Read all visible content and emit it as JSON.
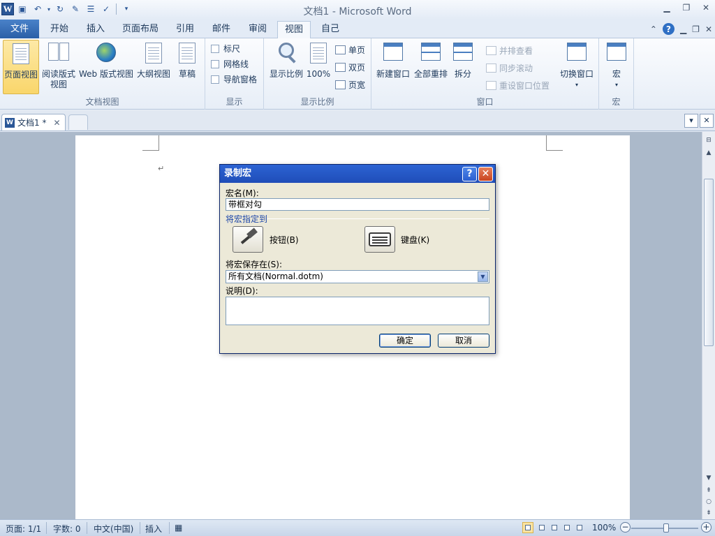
{
  "window": {
    "title": "文档1 - Microsoft Word",
    "app_icon_letter": "W"
  },
  "quick_access": {
    "save_icon": "save-icon",
    "undo_icon": "undo-icon",
    "redo_icon": "redo-icon",
    "customize_icon": "customize-arrow-icon"
  },
  "tabs": {
    "file": "文件",
    "items": [
      "开始",
      "插入",
      "页面布局",
      "引用",
      "邮件",
      "审阅",
      "视图",
      "自己"
    ],
    "active": "视图"
  },
  "ribbon": {
    "doc_views": {
      "label": "文档视图",
      "print_layout": "页面视图",
      "reading_line1": "阅读版式",
      "reading_line2": "视图",
      "web_layout": "Web 版式视图",
      "outline": "大纲视图",
      "draft": "草稿"
    },
    "show": {
      "label": "显示",
      "ruler": "标尺",
      "gridlines": "网格线",
      "nav_pane": "导航窗格"
    },
    "zoom": {
      "label": "显示比例",
      "zoom": "显示比例",
      "hundred": "100%",
      "one_page": "单页",
      "two_pages": "双页",
      "page_width": "页宽"
    },
    "window": {
      "label": "窗口",
      "new_window": "新建窗口",
      "arrange_all": "全部重排",
      "split": "拆分",
      "side_by_side": "并排查看",
      "sync_scroll": "同步滚动",
      "reset_position": "重设窗口位置",
      "switch_windows": "切换窗口"
    },
    "macros": {
      "label": "宏",
      "macros": "宏"
    }
  },
  "doc_tab": {
    "name": "文档1 *"
  },
  "dialog": {
    "title": "录制宏",
    "macro_name_label": "宏名(M):",
    "macro_name_value": "带框对勾",
    "assign_section": "将宏指定到",
    "button_label": "按钮(B)",
    "keyboard_label": "键盘(K)",
    "store_label": "将宏保存在(S):",
    "store_value": "所有文档(Normal.dotm)",
    "description_label": "说明(D):",
    "description_value": "",
    "ok": "确定",
    "cancel": "取消"
  },
  "status_bar": {
    "page": "页面: 1/1",
    "words": "字数: 0",
    "language": "中文(中国)",
    "mode": "插入",
    "zoom": "100%"
  }
}
